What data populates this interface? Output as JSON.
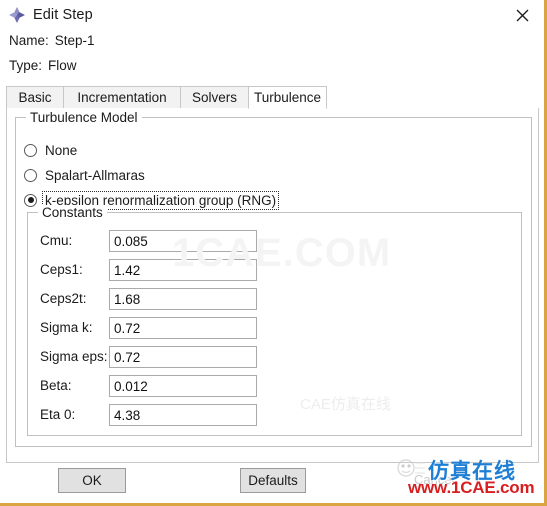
{
  "window": {
    "title": "Edit Step",
    "icon": "abaqus-diamond-icon",
    "close_label": "✕"
  },
  "header": {
    "name_label": "Name:",
    "name_value": "Step-1",
    "type_label": "Type:",
    "type_value": "Flow"
  },
  "tabs": [
    {
      "label": "Basic",
      "active": false
    },
    {
      "label": "Incrementation",
      "active": false
    },
    {
      "label": "Solvers",
      "active": false
    },
    {
      "label": "Turbulence",
      "active": true
    }
  ],
  "turbulence_model": {
    "group_title": "Turbulence Model",
    "options": [
      {
        "label": "None",
        "selected": false
      },
      {
        "label": "Spalart-Allmaras",
        "selected": false
      },
      {
        "label": "k-epsilon renormalization group (RNG)",
        "selected": true
      }
    ]
  },
  "constants": {
    "group_title": "Constants",
    "fields": [
      {
        "label": "Cmu:",
        "value": "0.085"
      },
      {
        "label": "Ceps1:",
        "value": "1.42"
      },
      {
        "label": "Ceps2t:",
        "value": "1.68"
      },
      {
        "label": "Sigma k:",
        "value": "0.72"
      },
      {
        "label": "Sigma eps:",
        "value": "0.72"
      },
      {
        "label": "Beta:",
        "value": "0.012"
      },
      {
        "label": "Eta 0:",
        "value": "4.38"
      }
    ]
  },
  "footer": {
    "ok_label": "OK",
    "defaults_label": "Defaults"
  },
  "watermarks": {
    "center": "1CAE.COM",
    "faint_small": "CAE仿真在线",
    "cancer_text": "Cancer",
    "brand_cn": "仿真在线",
    "brand_url": "www.1CAE.com"
  },
  "colors": {
    "accent_border": "#d9a441",
    "tab_inactive": "#f2f2f2",
    "button_face": "#e1e1e1",
    "brand_blue": "#1e7fd4",
    "brand_red": "#d81f20"
  }
}
